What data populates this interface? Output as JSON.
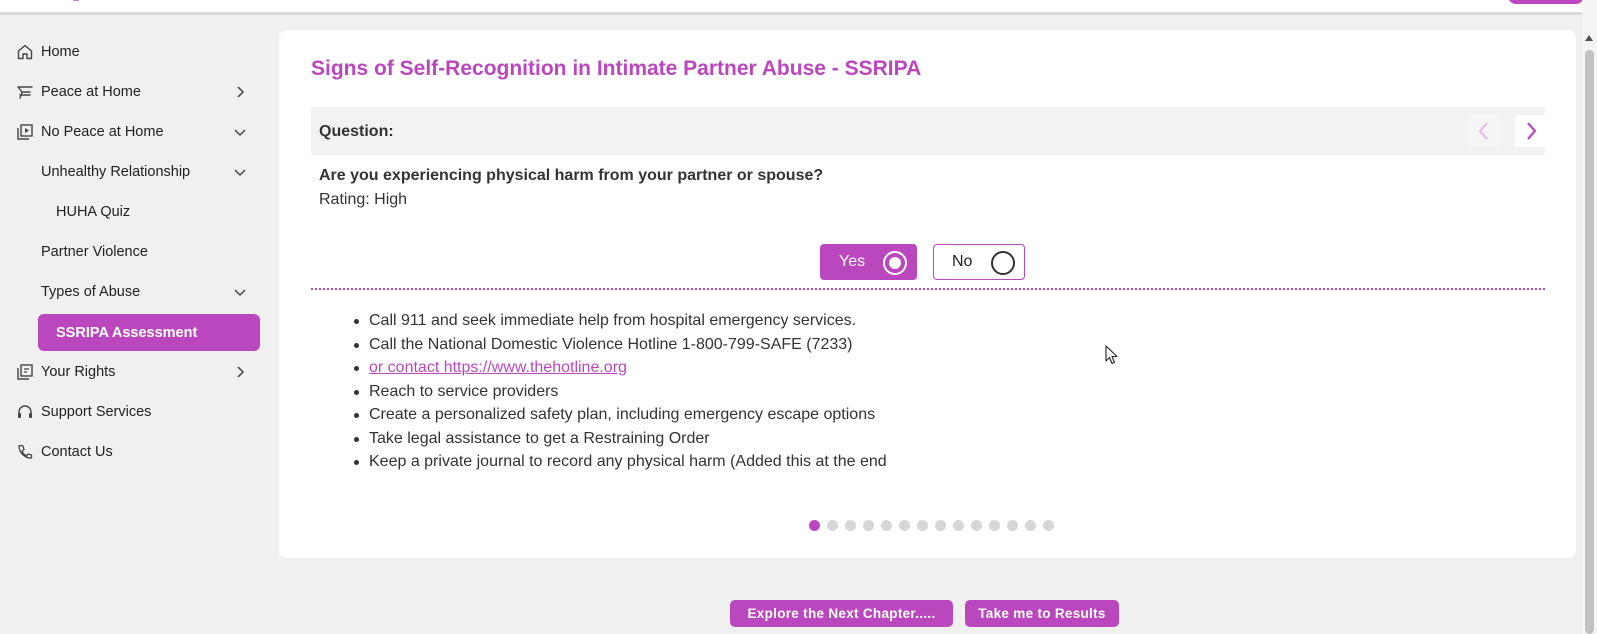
{
  "sidebar": {
    "items": [
      {
        "label": "Home",
        "icon": "home-icon"
      },
      {
        "label": "Peace at Home",
        "icon": "peace-icon"
      },
      {
        "label": "No Peace at Home",
        "icon": "media-library-icon"
      },
      {
        "label": "Unhealthy Relationship"
      },
      {
        "label": "HUHA Quiz"
      },
      {
        "label": "Partner Violence"
      },
      {
        "label": "Types of Abuse"
      },
      {
        "label": "SSRIPA Assessment"
      },
      {
        "label": "Your Rights",
        "icon": "rights-book-icon"
      },
      {
        "label": "Support Services",
        "icon": "headset-icon"
      },
      {
        "label": "Contact Us",
        "icon": "phone-icon"
      }
    ]
  },
  "main": {
    "title": "Signs of Self-Recognition in Intimate Partner Abuse - SSRIPA",
    "question_label": "Question:",
    "question": "Are you experiencing physical harm from your partner or spouse?",
    "rating": "Rating: High",
    "yes_label": "Yes",
    "no_label": "No",
    "selected": "Yes",
    "advice": [
      "Call 911 and seek immediate help from hospital emergency services.",
      "Call the National Domestic Violence Hotline 1-800-799-SAFE (7233)",
      "or contact https://www.thehotline.org",
      "Reach to service providers",
      "Create a personalized safety plan, including emergency escape options",
      "Take legal assistance to get a Restraining Order",
      "Keep a private journal to record any physical harm (Added this at the end"
    ],
    "pagination": {
      "total": 14,
      "current": 1
    }
  },
  "footer": {
    "next_chapter_label": "Explore the Next Chapter.....",
    "results_label": "Take me to Results"
  },
  "colors": {
    "accent": "#bb47bf",
    "background": "#f0f0f0",
    "card": "#ffffff"
  }
}
